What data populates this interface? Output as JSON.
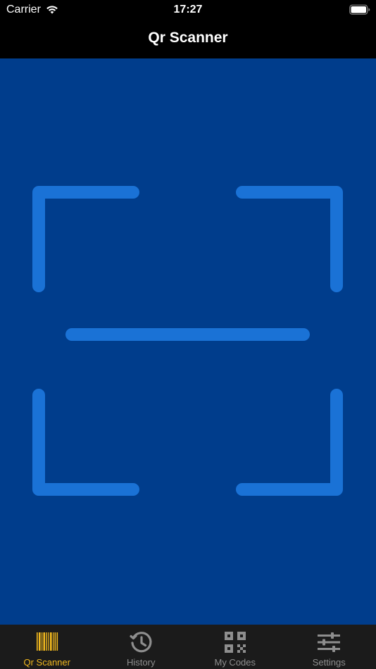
{
  "status_bar": {
    "carrier": "Carrier",
    "time": "17:27"
  },
  "nav": {
    "title": "Qr Scanner"
  },
  "scanner": {
    "background_color": "#003d8c",
    "frame_color": "#1a72d6"
  },
  "tabs": [
    {
      "label": "Qr Scanner",
      "icon": "barcode-icon",
      "active": true
    },
    {
      "label": "History",
      "icon": "history-icon",
      "active": false
    },
    {
      "label": "My Codes",
      "icon": "qr-code-icon",
      "active": false
    },
    {
      "label": "Settings",
      "icon": "sliders-icon",
      "active": false
    }
  ],
  "colors": {
    "tab_active": "#f2b91e",
    "tab_inactive": "#8e8e8e",
    "tab_bar_bg": "#1b1b1b"
  }
}
